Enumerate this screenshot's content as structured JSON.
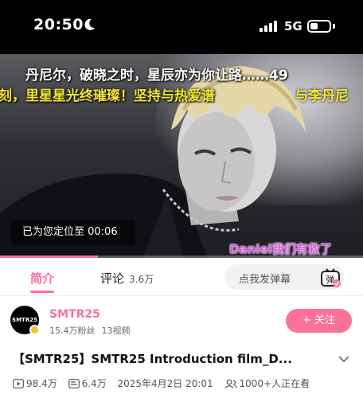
{
  "status_bar": {
    "time": "20:50",
    "network": "5G"
  },
  "video": {
    "danmaku": [
      "丹尼尔，破晓之时，星辰亦为你让路……49",
      "刻，里星星光终璀璨！坚持与热爱谱",
      "与李丹尼",
      "Daniel我们有救了"
    ],
    "toast": "已为您定位至 00:06",
    "progress_fraction": 0.27
  },
  "tabs": {
    "intro": "简介",
    "comments": "评论",
    "comments_count": "3.6万",
    "danmaku_placeholder": "点我发弹幕",
    "danmaku_button_glyph": "弹"
  },
  "uploader": {
    "name": "SMTR25",
    "avatar_text": "SMTR25",
    "fans": "15.4万粉丝",
    "videos": "13视频",
    "follow": "+ 关注"
  },
  "video_info": {
    "title": "【SMTR25】SMTR25 Introduction film_D...",
    "views": "98.4万",
    "danmaku_count": "6.4万",
    "date": "2025年4月2日 20:01",
    "watching": "1000+人正在看"
  },
  "colors": {
    "accent": "#fb7299",
    "danmaku_yellow": "#f7e733"
  }
}
